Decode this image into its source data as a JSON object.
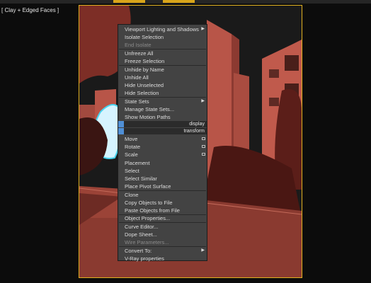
{
  "viewport": {
    "label": "[ Clay + Edged Faces ]"
  },
  "quad_headers": [
    "display",
    "transform"
  ],
  "menu": {
    "items": [
      {
        "label": "Viewport Lighting and Shadows",
        "submenu": true
      },
      {
        "label": "Isolate Selection"
      },
      {
        "label": "End Isolate",
        "disabled": true
      },
      {
        "label": "Unfreeze All"
      },
      {
        "label": "Freeze Selection"
      },
      {
        "label": "Unhide by Name"
      },
      {
        "label": "Unhide All"
      },
      {
        "label": "Hide Unselected"
      },
      {
        "label": "Hide Selection"
      },
      {
        "label": "State Sets",
        "submenu": true
      },
      {
        "label": "Manage State Sets..."
      },
      {
        "label": "Show Motion Paths"
      },
      {
        "label": "Move",
        "settings": true
      },
      {
        "label": "Rotate",
        "settings": true
      },
      {
        "label": "Scale",
        "settings": true
      },
      {
        "label": "Placement"
      },
      {
        "label": "Select"
      },
      {
        "label": "Select Similar"
      },
      {
        "label": "Place Pivot Surface"
      },
      {
        "label": "Clone"
      },
      {
        "label": "Copy Objects to File"
      },
      {
        "label": "Paste Objects from File"
      },
      {
        "label": "Object Properties..."
      },
      {
        "label": "Curve Editor..."
      },
      {
        "label": "Dope Sheet..."
      },
      {
        "label": "Wire Parameters...",
        "disabled": true
      },
      {
        "label": "Convert To:",
        "submenu": true
      },
      {
        "label": "V-Ray properties"
      }
    ]
  },
  "colors": {
    "viewport_border": "#e0b020",
    "menu_bg": "#434343",
    "quad_accent": "#4f8fd6",
    "building": "#b85548"
  },
  "icons": {
    "submenu": "triangle-right-icon",
    "settings": "settings-box-icon"
  }
}
